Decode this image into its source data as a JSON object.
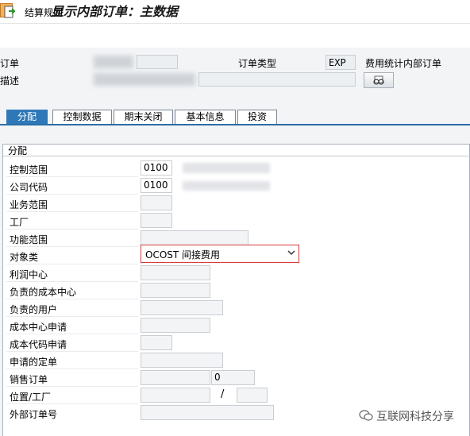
{
  "window": {
    "title": "显示内部订单：主数据"
  },
  "toolbar": {
    "settlement_rule_label": "结算规则"
  },
  "header": {
    "order_label": "订单",
    "order_type_label": "订单类型",
    "order_type_value": "EXP",
    "order_type_desc": "费用统计内部订单",
    "description_label": "描述"
  },
  "tabs": [
    {
      "label": "分配",
      "active": true
    },
    {
      "label": "控制数据",
      "active": false
    },
    {
      "label": "期末关闭",
      "active": false
    },
    {
      "label": "基本信息",
      "active": false
    },
    {
      "label": "投资",
      "active": false
    }
  ],
  "assignment": {
    "section_title": "分配",
    "controlling_area_label": "控制范围",
    "controlling_area_value": "0100",
    "company_code_label": "公司代码",
    "company_code_value": "0100",
    "business_area_label": "业务范围",
    "plant_label": "工厂",
    "functional_area_label": "功能范围",
    "object_class_label": "对象类",
    "object_class_value": "OCOST 间接费用",
    "profit_center_label": "利润中心",
    "resp_cost_center_label": "负责的成本中心",
    "resp_user_label": "负责的用户",
    "req_cost_center_label": "成本中心申请",
    "req_company_code_label": "成本代码申请",
    "requesting_order_label": "申请的定单",
    "sales_order_label": "销售订单",
    "sales_order_item_value": "0",
    "location_plant_label": "位置/工厂",
    "location_separator": "/",
    "external_order_label": "外部订单号"
  },
  "watermark": {
    "text": "互联网科技分享",
    "icon": "wechat-icon"
  },
  "colors": {
    "active_tab": "#2e78b8",
    "highlight_border": "#d63b3b"
  }
}
